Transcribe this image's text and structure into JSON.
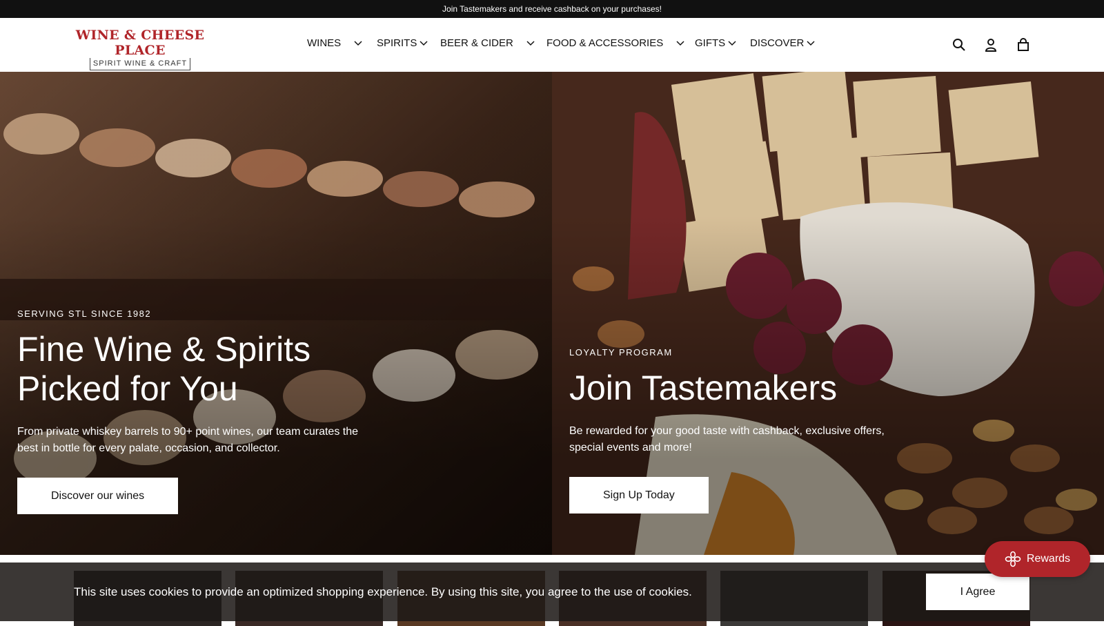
{
  "announcement": "Join Tastemakers and receive cashback on your purchases!",
  "logo": {
    "line1": "WINE & CHEESE PLACE",
    "line2": "SPIRIT WINE & CRAFT"
  },
  "nav": [
    {
      "label": "WINES"
    },
    {
      "label": "SPIRITS"
    },
    {
      "label": "BEER & CIDER"
    },
    {
      "label": "FOOD & ACCESSORIES"
    },
    {
      "label": "GIFTS"
    },
    {
      "label": "DISCOVER"
    }
  ],
  "header_icons": [
    "search-icon",
    "account-icon",
    "cart-bag-icon"
  ],
  "hero_left": {
    "eyebrow": "SERVING STL SINCE 1982",
    "title_line1": "Fine Wine & Spirits",
    "title_line2": "Picked for You",
    "description": "From private whiskey barrels to 90+ point wines, our team curates the best in bottle for every palate, occasion, and collector.",
    "button": "Discover our wines"
  },
  "hero_right": {
    "eyebrow": "LOYALTY PROGRAM",
    "title": "Join Tastemakers",
    "description": "Be rewarded for your good taste with cashback, exclusive offers, special events and more!",
    "button": "Sign Up Today"
  },
  "cookie": {
    "text": "This site uses cookies to provide an optimized shopping experience. By using this site, you agree to the use of cookies.",
    "button": "I Agree"
  },
  "rewards": {
    "label": "Rewards"
  },
  "colors": {
    "brand_red": "#b0252a",
    "announce_bg": "#111111"
  }
}
